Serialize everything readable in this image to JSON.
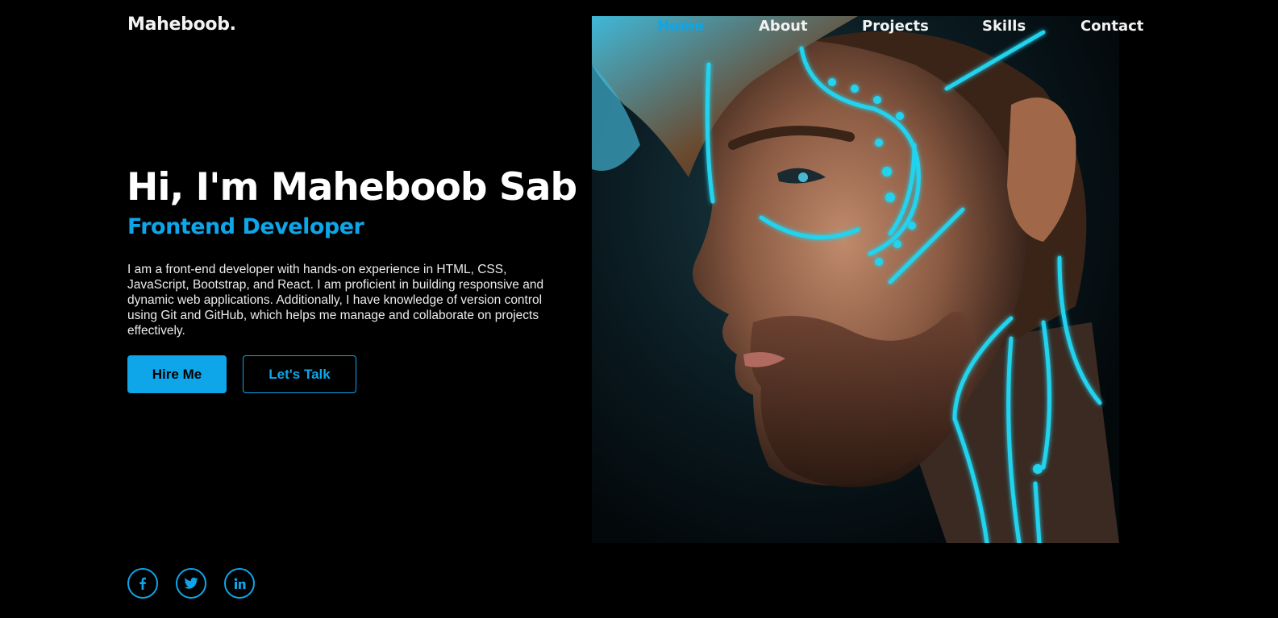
{
  "brand": {
    "logo": "Maheboob."
  },
  "nav": {
    "items": [
      {
        "label": "Home",
        "active": true
      },
      {
        "label": "About",
        "active": false
      },
      {
        "label": "Projects",
        "active": false
      },
      {
        "label": "Skills",
        "active": false
      },
      {
        "label": "Contact",
        "active": false
      }
    ]
  },
  "hero": {
    "title": "Hi, I'm Maheboob Sab",
    "subtitle": "Frontend Developer",
    "description": "I am a front-end developer with hands-on experience in HTML, CSS, JavaScript, Bootstrap, and React. I am proficient in building responsive and dynamic web applications. Additionally, I have knowledge of version control using Git and GitHub, which helps me manage and collaborate on projects effectively.",
    "primary_button": "Hire Me",
    "secondary_button": "Let's Talk",
    "image_icon": "portrait-photo-icon"
  },
  "social": [
    {
      "icon": "facebook-icon"
    },
    {
      "icon": "twitter-icon"
    },
    {
      "icon": "linkedin-icon"
    }
  ],
  "colors": {
    "background": "#000000",
    "accent": "#0ea5e9",
    "text": "#ffffff"
  }
}
